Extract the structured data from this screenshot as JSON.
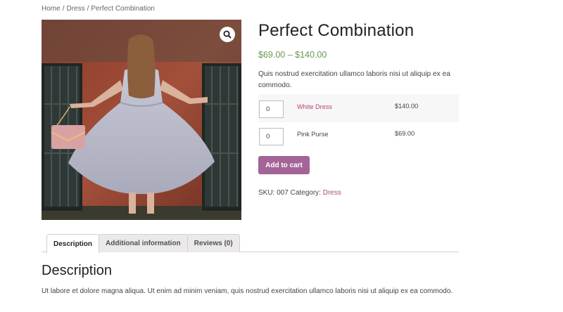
{
  "breadcrumb": {
    "home": "Home",
    "category": "Dress",
    "current": "Perfect Combination",
    "separator": "/"
  },
  "product": {
    "title": "Perfect Combination",
    "price_range": "$69.00 – $140.00",
    "short_description": "Quis nostrud exercitation ullamco laboris nisi ut aliquip ex ea commodo.",
    "image_icon": "zoom-magnifier-icon",
    "grouped_items": [
      {
        "qty": "0",
        "name": "White Dress",
        "price": "$140.00",
        "is_link": true
      },
      {
        "qty": "0",
        "name": "Pink Purse",
        "price": "$69.00",
        "is_link": false
      }
    ],
    "add_to_cart_label": "Add to cart",
    "sku_label": "SKU:",
    "sku": "007",
    "category_label": "Category:",
    "category": "Dress"
  },
  "tabs": [
    {
      "label": "Description",
      "active": true
    },
    {
      "label": "Additional information",
      "active": false
    },
    {
      "label": "Reviews (0)",
      "active": false
    }
  ],
  "description": {
    "heading": "Description",
    "text": "Ut labore et dolore magna aliqua. Ut enim ad minim veniam, quis nostrud exercitation ullamco laboris nisi ut aliquip ex ea commodo."
  },
  "colors": {
    "price": "#6a9a4f",
    "accent_link": "#b0487d",
    "button": "#a46497"
  }
}
